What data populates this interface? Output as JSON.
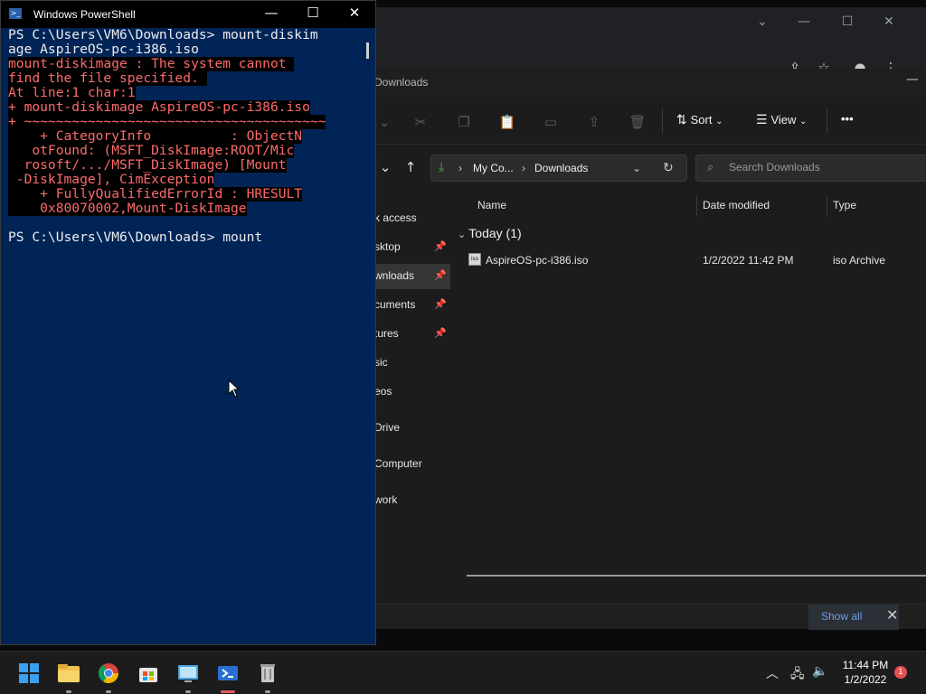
{
  "powershell": {
    "title": "Windows PowerShell",
    "icon": "powershell-icon",
    "controls": [
      "—",
      "☐",
      "✕"
    ],
    "lines": [
      {
        "text": "PS C:\\Users\\VM6\\Downloads> mount-diskim",
        "kind": "normal"
      },
      {
        "text": "age AspireOS-pc-i386.iso",
        "kind": "normal"
      },
      {
        "text": "mount-diskimage : The system cannot ",
        "kind": "error"
      },
      {
        "text": "find the file specified. ",
        "kind": "error"
      },
      {
        "text": "At line:1 char:1",
        "kind": "error"
      },
      {
        "text": "+ mount-diskimage AspireOS-pc-i386.iso",
        "kind": "error"
      },
      {
        "text": "+ ~~~~~~~~~~~~~~~~~~~~~~~~~~~~~~~~~~~~~~",
        "kind": "error"
      },
      {
        "text": "    + CategoryInfo          : ObjectN",
        "kind": "error"
      },
      {
        "text": "   otFound: (MSFT_DiskImage:ROOT/Mic",
        "kind": "error"
      },
      {
        "text": "  rosoft/.../MSFT_DiskImage) [Mount",
        "kind": "error"
      },
      {
        "text": " -DiskImage], CimException",
        "kind": "error"
      },
      {
        "text": "    + FullyQualifiedErrorId : HRESULT",
        "kind": "error"
      },
      {
        "text": "    0x80070002,Mount-DiskImage",
        "kind": "error"
      },
      {
        "text": "",
        "kind": "normal"
      },
      {
        "text": "PS C:\\Users\\VM6\\Downloads> mount",
        "kind": "normal"
      }
    ],
    "bg_color": "#012456",
    "error_color": "#ff6a6a"
  },
  "explorer": {
    "title": "Downloads",
    "toolbar": {
      "cut_icon": "scissors-icon",
      "copy_icon": "copy-icon",
      "paste_icon": "paste-icon",
      "rename_icon": "rename-icon",
      "share_icon": "share-icon",
      "delete_icon": "trash-icon",
      "sort_label": "Sort",
      "view_label": "View",
      "more_label": "•••"
    },
    "address": {
      "crumb1": "My Co...",
      "crumb2": "Downloads"
    },
    "search": {
      "placeholder": "Search Downloads"
    },
    "nav": [
      {
        "label": "k access",
        "pinned": false
      },
      {
        "label": "sktop",
        "pinned": true
      },
      {
        "label": "wnloads",
        "pinned": true
      },
      {
        "label": "cuments",
        "pinned": true
      },
      {
        "label": "tures",
        "pinned": true
      },
      {
        "label": "sic",
        "pinned": false
      },
      {
        "label": "eos",
        "pinned": false
      },
      {
        "label": "Drive",
        "pinned": false
      },
      {
        "label": "Computer",
        "pinned": false
      },
      {
        "label": "work",
        "pinned": false
      }
    ],
    "columns": {
      "name": "Name",
      "date": "Date modified",
      "type": "Type"
    },
    "group": "Today (1)",
    "files": [
      {
        "name": "AspireOS-pc-i386.iso",
        "date": "1/2/2022 11:42 PM",
        "type": "iso Archive",
        "icon_label": "iso"
      }
    ],
    "notification": {
      "show_all": "Show all"
    }
  },
  "taskbar": {
    "apps": [
      {
        "name": "start-icon"
      },
      {
        "name": "file-explorer-icon"
      },
      {
        "name": "chrome-icon"
      },
      {
        "name": "store-icon"
      },
      {
        "name": "control-panel-icon"
      },
      {
        "name": "powershell-icon"
      },
      {
        "name": "recycle-bin-icon"
      }
    ],
    "clock": {
      "time": "11:44 PM",
      "date": "1/2/2022"
    },
    "notification_count": "1"
  }
}
